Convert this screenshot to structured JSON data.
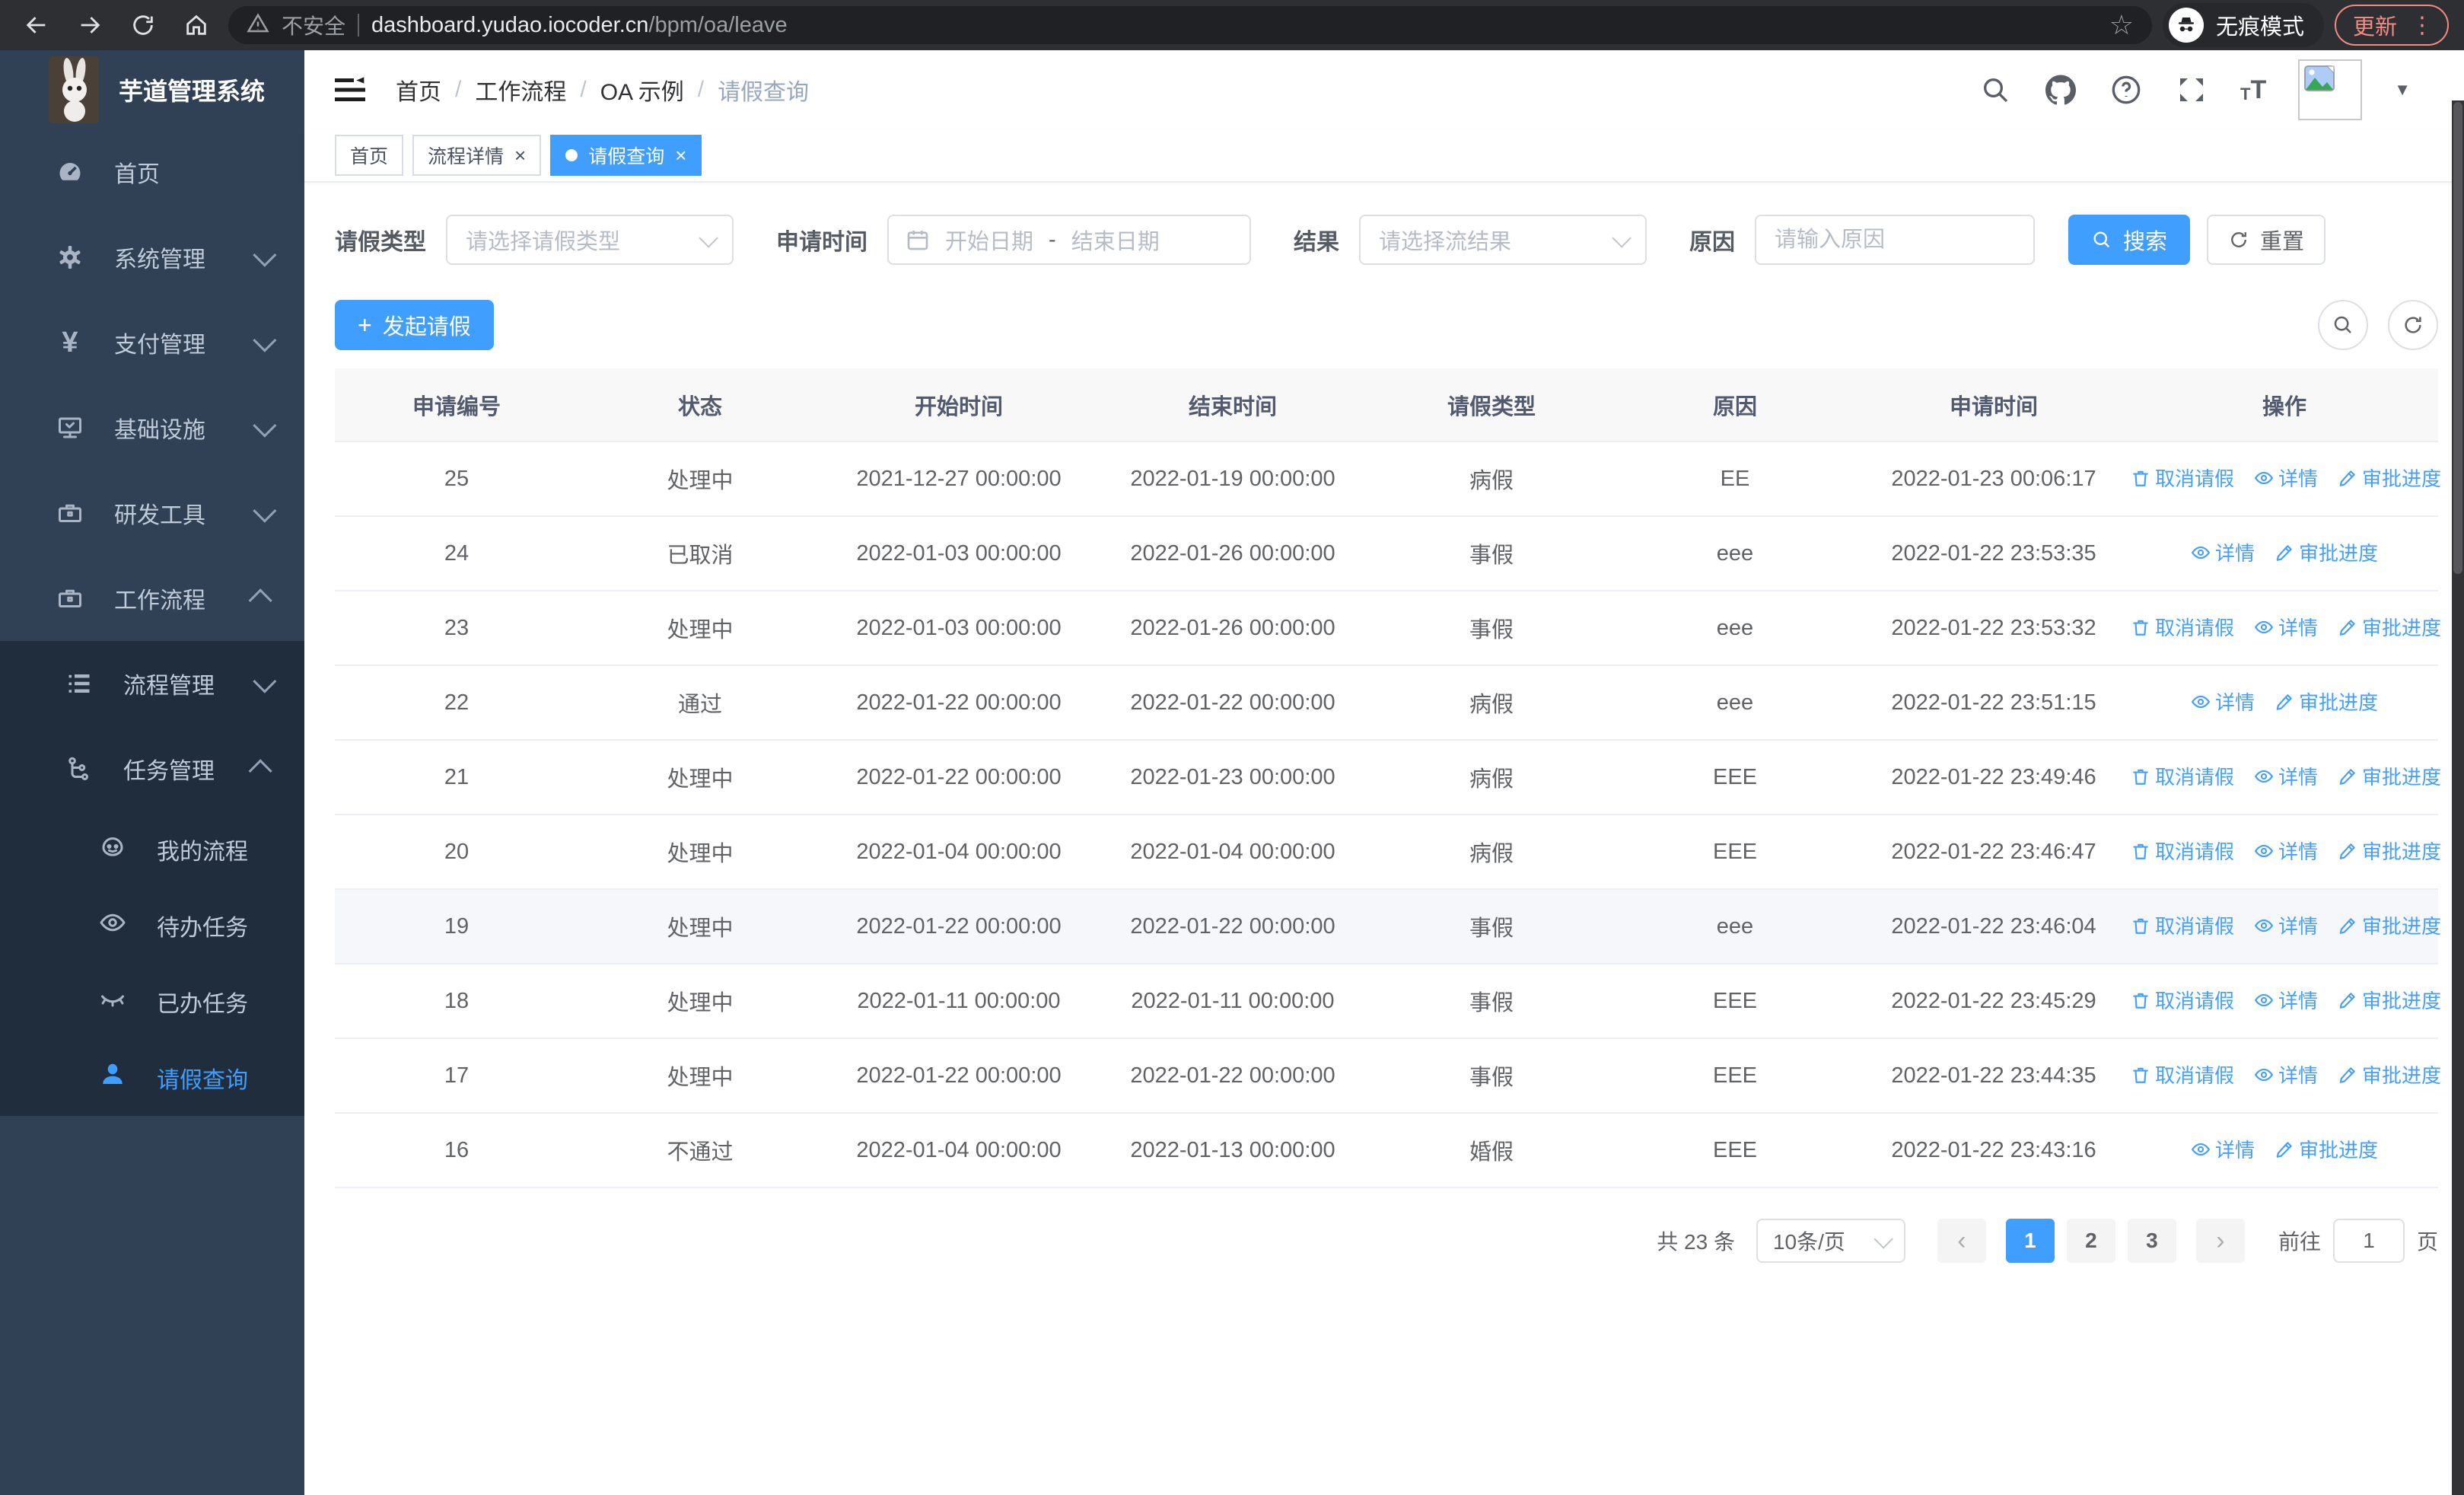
{
  "browser": {
    "security_label": "不安全",
    "url_domain": "dashboard.yudao.iocoder.cn",
    "url_path": "/bpm/oa/leave",
    "incognito_label": "无痕模式",
    "update_label": "更新"
  },
  "icons": {
    "star_glyph": "☆",
    "more_dots_glyph": "⋮",
    "caret_down_glyph": "▼",
    "help_glyph": "?",
    "font_size_big_glyph": "T",
    "font_size_small_glyph": "T",
    "yen_glyph": "¥",
    "breadcrumb_separator": "/",
    "close_glyph": "×",
    "plus_glyph": "+",
    "prev_glyph": "‹",
    "next_glyph": "›"
  },
  "colors": {
    "accent": "#409eff",
    "sidebar_bg": "#304156",
    "submenu_bg": "#1f2d3d",
    "update_chip": "#f18b82",
    "link_blue": "#459fff",
    "tag_active_bg": "#409eff"
  },
  "sidebar": {
    "title": "芋道管理系统",
    "menu": [
      {
        "label": "首页",
        "icon": "dashboard-icon",
        "arrow": null
      },
      {
        "label": "系统管理",
        "icon": "gear-icon",
        "arrow": "down"
      },
      {
        "label": "支付管理",
        "icon": "yen-icon",
        "arrow": "down"
      },
      {
        "label": "基础设施",
        "icon": "monitor-icon",
        "arrow": "down"
      },
      {
        "label": "研发工具",
        "icon": "toolbox-icon",
        "arrow": "down"
      },
      {
        "label": "工作流程",
        "icon": "briefcase-icon",
        "arrow": "up"
      }
    ],
    "submenu": [
      {
        "label": "流程管理",
        "icon": "flow-list-icon",
        "arrow": "down",
        "children": []
      },
      {
        "label": "任务管理",
        "icon": "task-tree-icon",
        "arrow": "up",
        "children": [
          {
            "label": "我的流程",
            "icon": "robot-icon",
            "active": false
          },
          {
            "label": "待办任务",
            "icon": "eye-icon",
            "active": false
          },
          {
            "label": "已办任务",
            "icon": "eye-closed-icon",
            "active": false
          },
          {
            "label": "请假查询",
            "icon": "user-icon",
            "active": true
          }
        ]
      }
    ]
  },
  "navbar": {
    "breadcrumb": [
      "首页",
      "工作流程",
      "OA 示例",
      "请假查询"
    ]
  },
  "tags": [
    {
      "label": "首页",
      "closable": false,
      "active": false
    },
    {
      "label": "流程详情",
      "closable": true,
      "active": false
    },
    {
      "label": "请假查询",
      "closable": true,
      "active": true
    }
  ],
  "filters": {
    "leave_type_label": "请假类型",
    "leave_type_placeholder": "请选择请假类型",
    "apply_time_label": "申请时间",
    "start_date_placeholder": "开始日期",
    "date_separator": "-",
    "end_date_placeholder": "结束日期",
    "result_label": "结果",
    "result_placeholder": "请选择流结果",
    "reason_label": "原因",
    "reason_placeholder": "请输入原因",
    "search_button": "搜索",
    "reset_button": "重置"
  },
  "toolbar": {
    "create_button": "发起请假"
  },
  "table": {
    "columns": [
      "申请编号",
      "状态",
      "开始时间",
      "结束时间",
      "请假类型",
      "原因",
      "申请时间",
      "操作"
    ],
    "action_labels": {
      "cancel": "取消请假",
      "detail": "详情",
      "progress": "审批进度"
    },
    "rows": [
      {
        "id": "25",
        "status": "处理中",
        "start": "2021-12-27 00:00:00",
        "end": "2022-01-19 00:00:00",
        "type": "病假",
        "reason": "EE",
        "applied": "2022-01-23 00:06:17",
        "cancellable": true,
        "highlight": false
      },
      {
        "id": "24",
        "status": "已取消",
        "start": "2022-01-03 00:00:00",
        "end": "2022-01-26 00:00:00",
        "type": "事假",
        "reason": "eee",
        "applied": "2022-01-22 23:53:35",
        "cancellable": false,
        "highlight": false
      },
      {
        "id": "23",
        "status": "处理中",
        "start": "2022-01-03 00:00:00",
        "end": "2022-01-26 00:00:00",
        "type": "事假",
        "reason": "eee",
        "applied": "2022-01-22 23:53:32",
        "cancellable": true,
        "highlight": false
      },
      {
        "id": "22",
        "status": "通过",
        "start": "2022-01-22 00:00:00",
        "end": "2022-01-22 00:00:00",
        "type": "病假",
        "reason": "eee",
        "applied": "2022-01-22 23:51:15",
        "cancellable": false,
        "highlight": false
      },
      {
        "id": "21",
        "status": "处理中",
        "start": "2022-01-22 00:00:00",
        "end": "2022-01-23 00:00:00",
        "type": "病假",
        "reason": "EEE",
        "applied": "2022-01-22 23:49:46",
        "cancellable": true,
        "highlight": false
      },
      {
        "id": "20",
        "status": "处理中",
        "start": "2022-01-04 00:00:00",
        "end": "2022-01-04 00:00:00",
        "type": "病假",
        "reason": "EEE",
        "applied": "2022-01-22 23:46:47",
        "cancellable": true,
        "highlight": false
      },
      {
        "id": "19",
        "status": "处理中",
        "start": "2022-01-22 00:00:00",
        "end": "2022-01-22 00:00:00",
        "type": "事假",
        "reason": "eee",
        "applied": "2022-01-22 23:46:04",
        "cancellable": true,
        "highlight": true
      },
      {
        "id": "18",
        "status": "处理中",
        "start": "2022-01-11 00:00:00",
        "end": "2022-01-11 00:00:00",
        "type": "事假",
        "reason": "EEE",
        "applied": "2022-01-22 23:45:29",
        "cancellable": true,
        "highlight": false
      },
      {
        "id": "17",
        "status": "处理中",
        "start": "2022-01-22 00:00:00",
        "end": "2022-01-22 00:00:00",
        "type": "事假",
        "reason": "EEE",
        "applied": "2022-01-22 23:44:35",
        "cancellable": true,
        "highlight": false
      },
      {
        "id": "16",
        "status": "不通过",
        "start": "2022-01-04 00:00:00",
        "end": "2022-01-13 00:00:00",
        "type": "婚假",
        "reason": "EEE",
        "applied": "2022-01-22 23:43:16",
        "cancellable": false,
        "highlight": false
      }
    ]
  },
  "pagination": {
    "total": "共 23 条",
    "page_size": "10条/页",
    "pages": [
      "1",
      "2",
      "3"
    ],
    "active_page": "1",
    "goto_label": "前往",
    "goto_value": "1",
    "goto_suffix": "页"
  }
}
